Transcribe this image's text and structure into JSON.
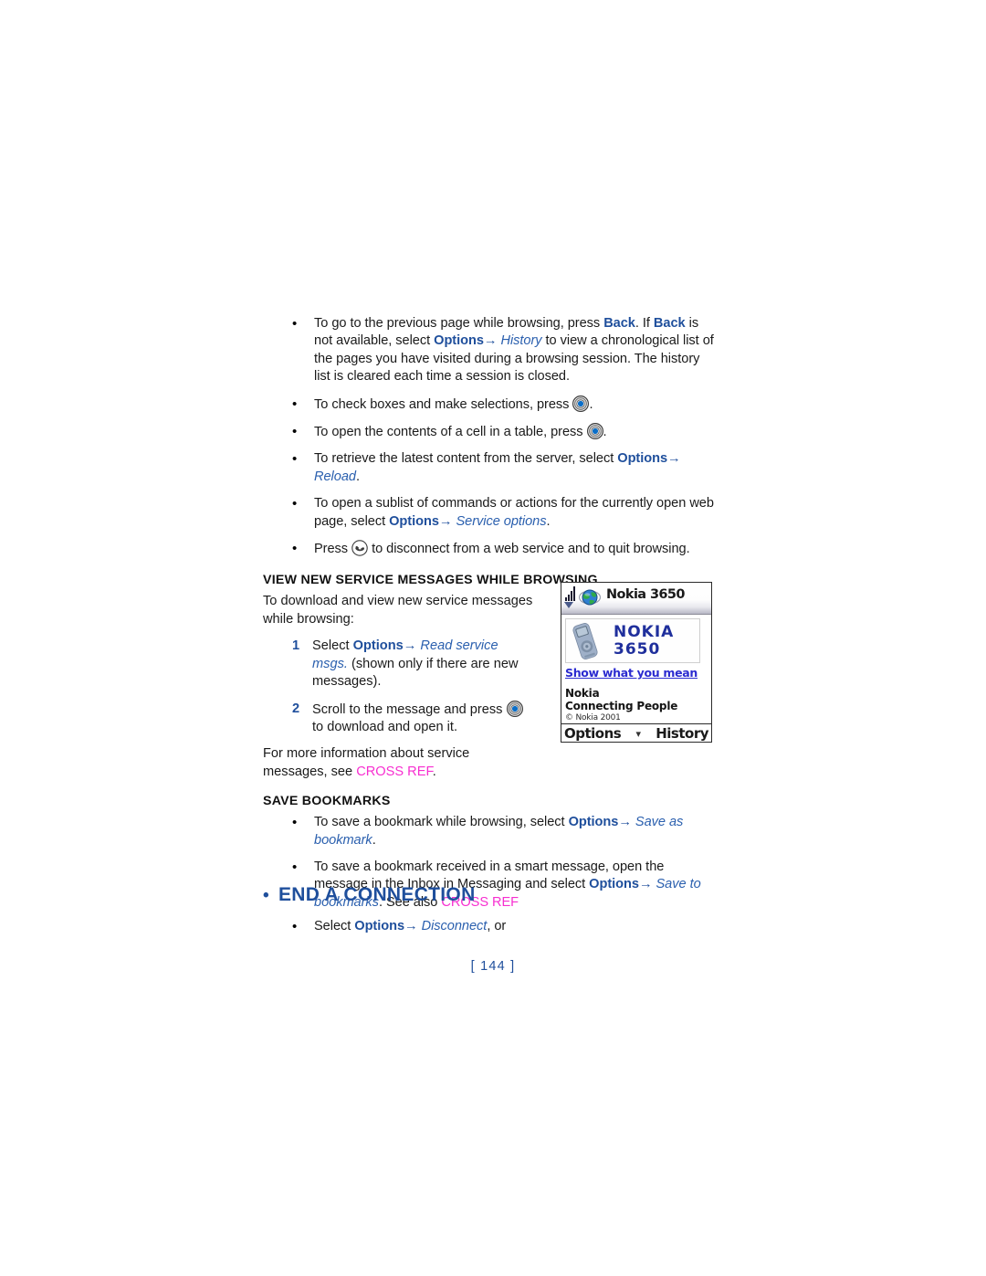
{
  "document": {
    "page_number": "[ 144 ]"
  },
  "browsing_tips": [
    {
      "segments": [
        {
          "t": "To go to the previous page while browsing, press ",
          "s": "plain"
        },
        {
          "t": "Back",
          "s": "cmd"
        },
        {
          "t": ". If ",
          "s": "plain"
        },
        {
          "t": "Back",
          "s": "cmd"
        },
        {
          "t": " is not available, select ",
          "s": "plain"
        },
        {
          "t": "Options",
          "s": "cmd"
        },
        {
          "t": "→",
          "s": "arrow"
        },
        {
          "t": " ",
          "s": "plain"
        },
        {
          "t": "History",
          "s": "itl"
        },
        {
          "t": " to view a chronological list of the pages you have visited during a browsing session. The history list is cleared each time a session is closed.",
          "s": "plain"
        }
      ]
    },
    {
      "segments": [
        {
          "t": "To check boxes and make selections, press ",
          "s": "plain"
        },
        {
          "t": "",
          "s": "icon-scroll-key"
        },
        {
          "t": ".",
          "s": "plain"
        }
      ]
    },
    {
      "segments": [
        {
          "t": "To open the contents of a cell in a table, press ",
          "s": "plain"
        },
        {
          "t": "",
          "s": "icon-scroll-key"
        },
        {
          "t": ".",
          "s": "plain"
        }
      ]
    },
    {
      "segments": [
        {
          "t": "To retrieve the latest content from the server, select ",
          "s": "plain"
        },
        {
          "t": "Options",
          "s": "cmd"
        },
        {
          "t": "→",
          "s": "arrow"
        },
        {
          "t": " ",
          "s": "plain"
        },
        {
          "t": "Reload",
          "s": "itl"
        },
        {
          "t": ".",
          "s": "plain"
        }
      ]
    },
    {
      "segments": [
        {
          "t": "To open a sublist of commands or actions for the currently open web page, select ",
          "s": "plain"
        },
        {
          "t": "Options",
          "s": "cmd"
        },
        {
          "t": "→",
          "s": "arrow"
        },
        {
          "t": " ",
          "s": "plain"
        },
        {
          "t": "Service options",
          "s": "itl"
        },
        {
          "t": ".",
          "s": "plain"
        }
      ]
    },
    {
      "segments": [
        {
          "t": "Press ",
          "s": "plain"
        },
        {
          "t": "",
          "s": "icon-end-key"
        },
        {
          "t": " to disconnect from a web service and to quit browsing.",
          "s": "plain"
        }
      ]
    }
  ],
  "view_messages_section": {
    "heading": "VIEW NEW SERVICE MESSAGES WHILE BROWSING",
    "intro": "To download and view new service messages while browsing:",
    "steps": [
      {
        "number": "1",
        "segments": [
          {
            "t": "Select ",
            "s": "plain"
          },
          {
            "t": "Options",
            "s": "cmd"
          },
          {
            "t": "→",
            "s": "arrow"
          },
          {
            "t": " ",
            "s": "plain"
          },
          {
            "t": "Read service msgs.",
            "s": "itl"
          },
          {
            "t": " (shown only if there are new messages).",
            "s": "plain"
          }
        ]
      },
      {
        "number": "2",
        "segments": [
          {
            "t": "Scroll to the message and press ",
            "s": "plain"
          },
          {
            "t": "",
            "s": "icon-scroll-key"
          },
          {
            "t": " to download and open it.",
            "s": "plain"
          }
        ]
      }
    ],
    "more_info": [
      {
        "t": "For more information about service messages, see ",
        "s": "plain"
      },
      {
        "t": "CROSS REF",
        "s": "xref"
      },
      {
        "t": ".",
        "s": "plain"
      }
    ]
  },
  "save_bookmarks_section": {
    "heading": "SAVE BOOKMARKS",
    "items": [
      {
        "segments": [
          {
            "t": "To save a bookmark while browsing, select ",
            "s": "plain"
          },
          {
            "t": "Options",
            "s": "cmd"
          },
          {
            "t": "→",
            "s": "arrow"
          },
          {
            "t": " ",
            "s": "plain"
          },
          {
            "t": "Save as bookmark",
            "s": "itl"
          },
          {
            "t": ".",
            "s": "plain"
          }
        ]
      },
      {
        "segments": [
          {
            "t": "To save a bookmark received in a smart message, open the message in the Inbox in Messaging and select ",
            "s": "plain"
          },
          {
            "t": "Options",
            "s": "cmd"
          },
          {
            "t": "→",
            "s": "arrow"
          },
          {
            "t": " ",
            "s": "plain"
          },
          {
            "t": "Save to bookmarks",
            "s": "itl"
          },
          {
            "t": ". See also ",
            "s": "plain"
          },
          {
            "t": "CROSS REF",
            "s": "xref"
          }
        ]
      }
    ]
  },
  "end_connection_section": {
    "bullet": "•",
    "heading": "END A CONNECTION",
    "items": [
      {
        "segments": [
          {
            "t": "Select ",
            "s": "plain"
          },
          {
            "t": "Options",
            "s": "cmd"
          },
          {
            "t": "→",
            "s": "arrow"
          },
          {
            "t": " ",
            "s": "plain"
          },
          {
            "t": "Disconnect",
            "s": "itl"
          },
          {
            "t": ", or",
            "s": "plain"
          }
        ]
      }
    ]
  },
  "phone_figure": {
    "title": "Nokia 3650",
    "banner_brand": "NOKIA",
    "banner_model": "3650",
    "link_text": "Show what you mean",
    "slogan_line1": "Nokia",
    "slogan_line2": "Connecting People",
    "copyright": "© Nokia 2001",
    "softkey_left": "Options",
    "softkey_right": "History",
    "icons": {
      "signal": "signal-bars-icon",
      "globe": "globe-icon",
      "scroll_down": "chevron-down-icon"
    }
  },
  "colors": {
    "accent_blue": "#1f4f9c",
    "italic_blue": "#2a5fae",
    "cross_ref_magenta": "#f72ed0",
    "text": "#1a1a1a",
    "phone_link_blue": "#2b2bd0",
    "phone_wordmark_blue": "#1f2f9c"
  }
}
